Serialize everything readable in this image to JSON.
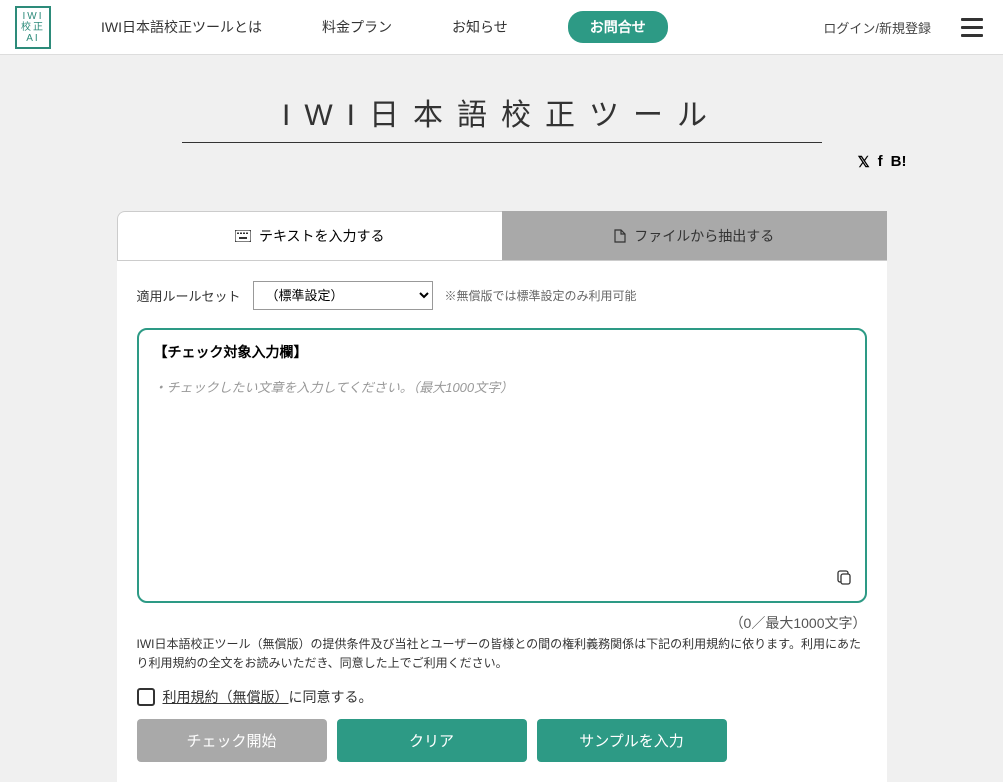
{
  "logo": {
    "line1": "IWI",
    "line2": "校正",
    "line3": "AI"
  },
  "nav": {
    "about": "IWI日本語校正ツールとは",
    "pricing": "料金プラン",
    "news": "お知らせ",
    "contact": "お問合せ",
    "login": "ログイン/新規登録"
  },
  "page_title": "IWI日本語校正ツール",
  "social": {
    "x": "𝕏",
    "f": "f",
    "b": "B!"
  },
  "tabs": {
    "text_input": "テキストを入力する",
    "file_extract": "ファイルから抽出する"
  },
  "ruleset": {
    "label": "適用ルールセット",
    "selected": "（標準設定）",
    "note": "※無償版では標準設定のみ利用可能"
  },
  "input_box": {
    "title": "【チェック対象入力欄】",
    "placeholder": "・チェックしたい文章を入力してください。（最大1000文字）"
  },
  "char_count": "（0／最大1000文字）",
  "terms_text": "IWI日本語校正ツール（無償版）の提供条件及び当社とユーザーの皆様との間の権利義務関係は下記の利用規約に依ります。利用にあたり利用規約の全文をお読みいただき、同意した上でご利用ください。",
  "agree": {
    "link_text": "利用規約（無償版）",
    "suffix": "に同意する。"
  },
  "buttons": {
    "check": "チェック開始",
    "clear": "クリア",
    "sample": "サンプルを入力"
  }
}
